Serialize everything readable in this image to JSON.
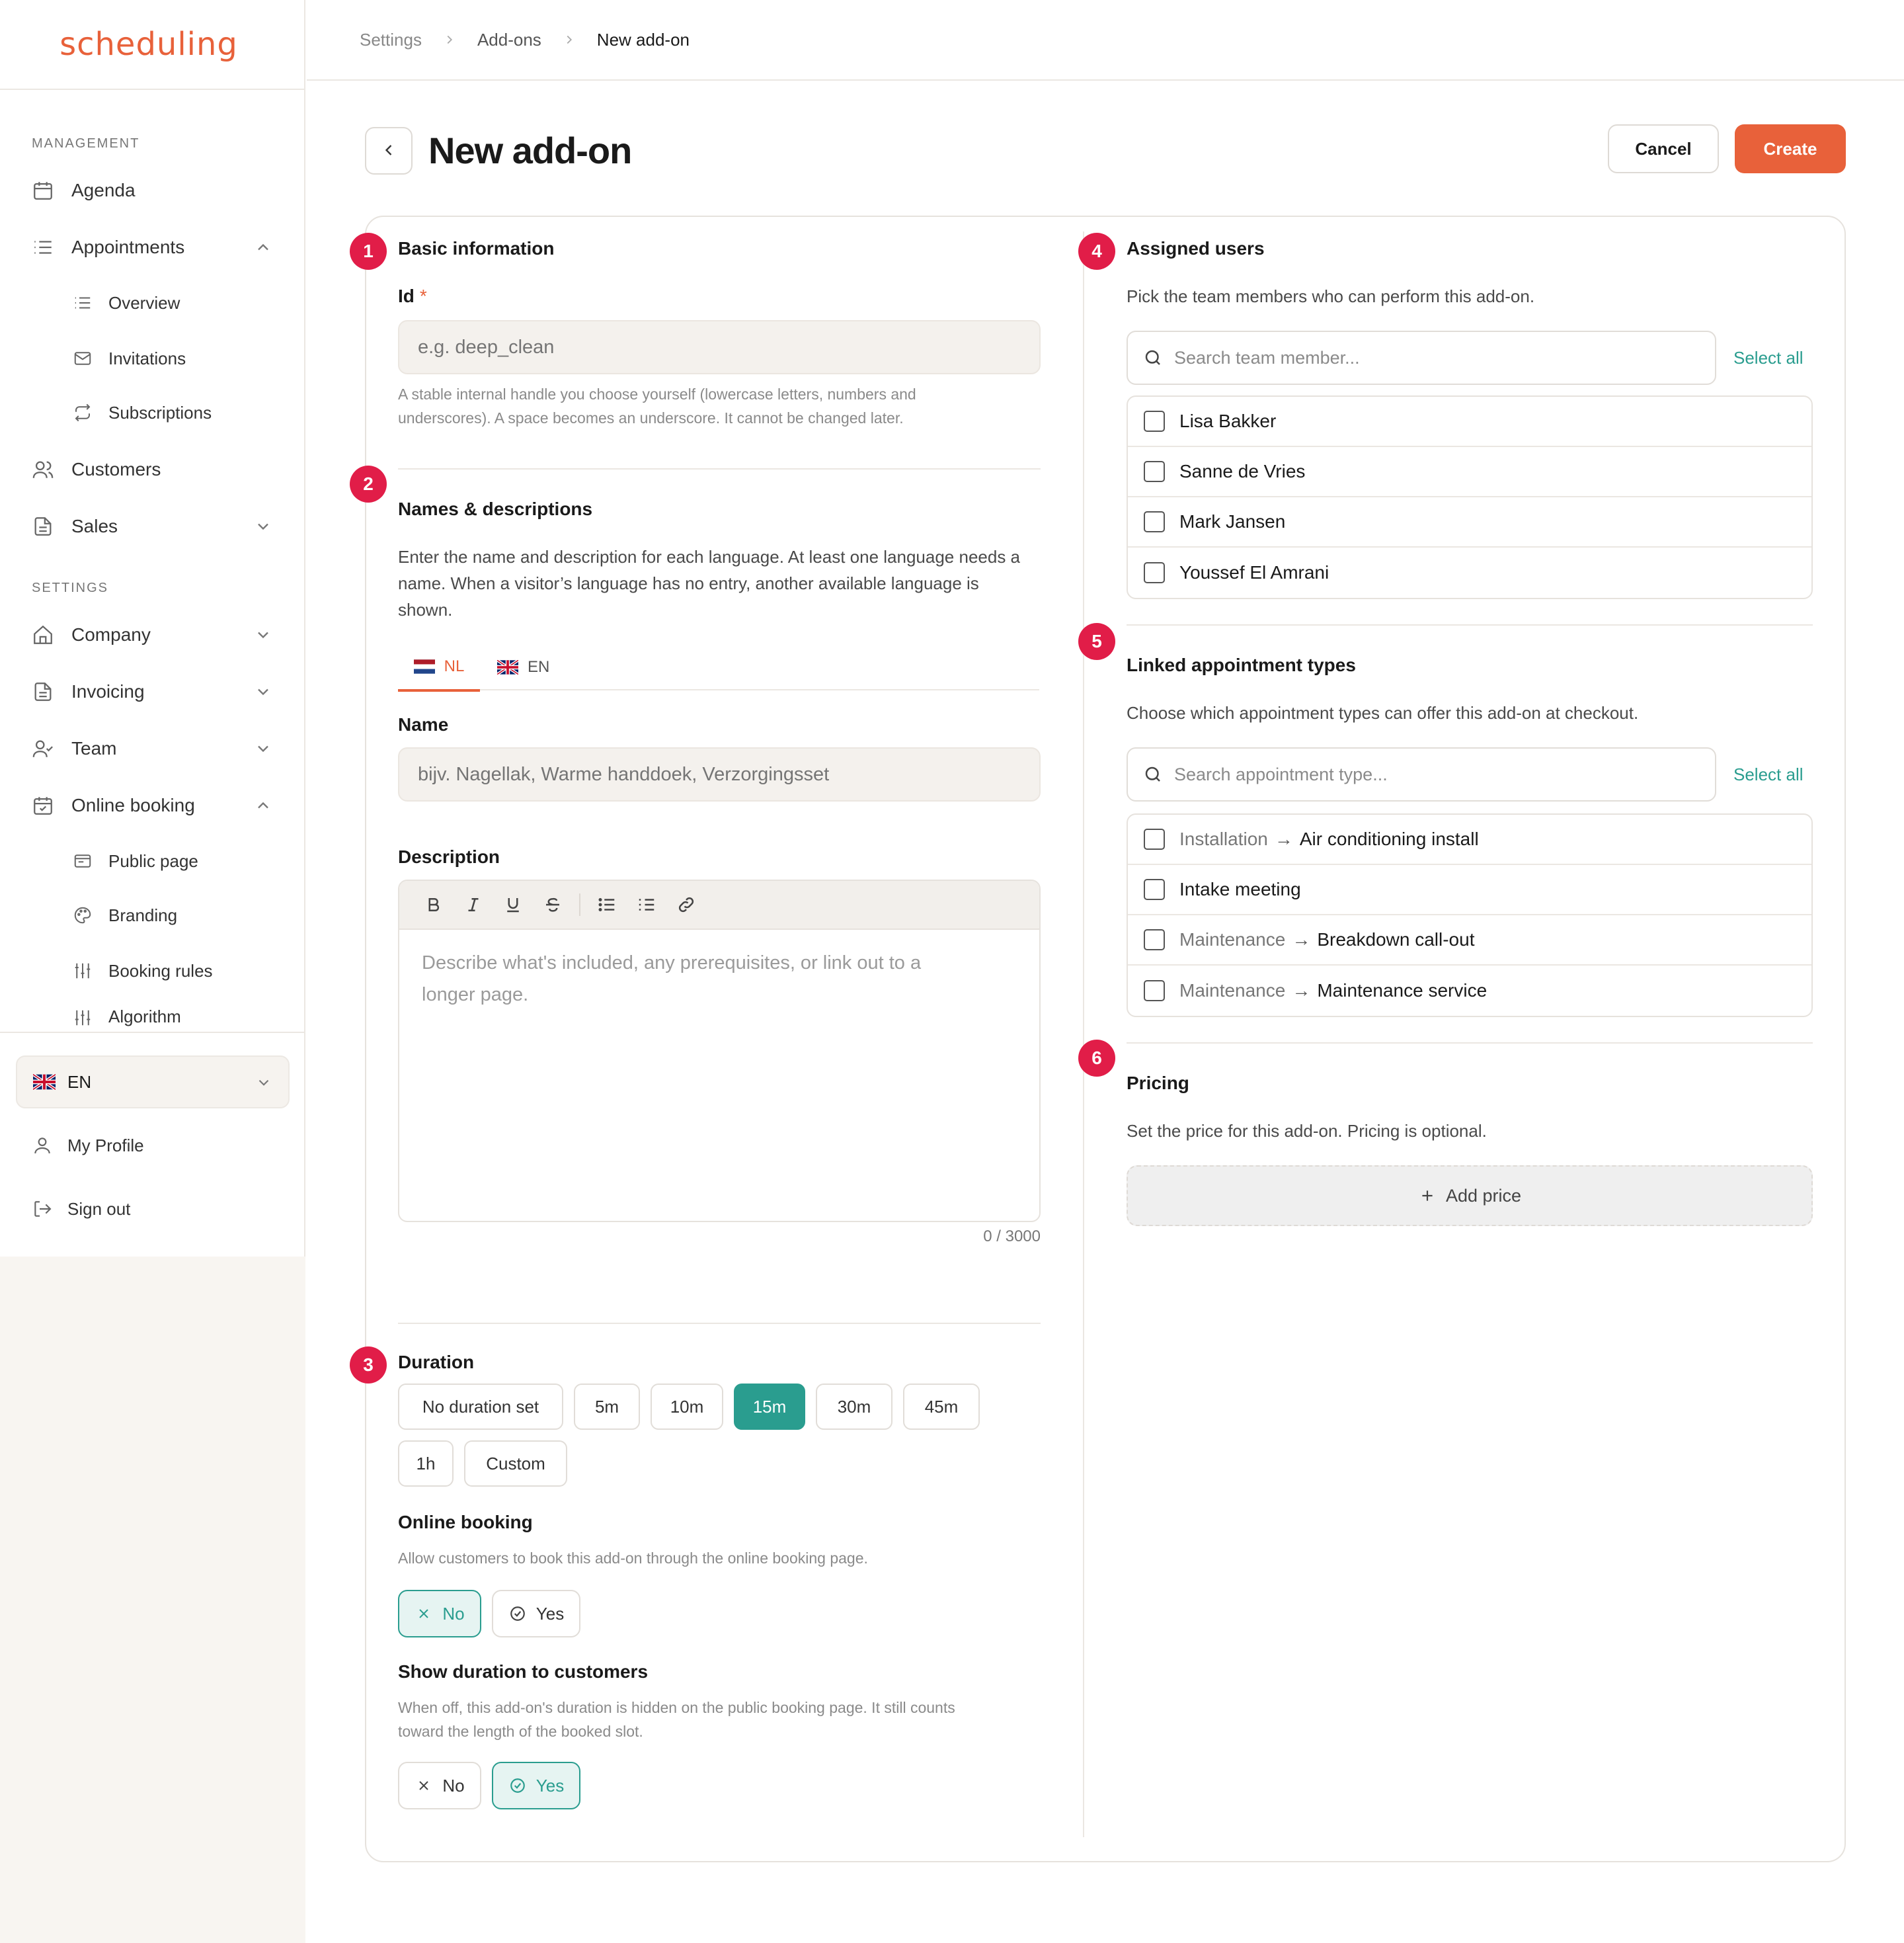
{
  "app": {
    "logo": "scheduling"
  },
  "sidebar": {
    "management_label": "MANAGEMENT",
    "settings_label": "SETTINGS",
    "items": {
      "agenda": "Agenda",
      "appointments": "Appointments",
      "overview": "Overview",
      "invitations": "Invitations",
      "subscriptions": "Subscriptions",
      "customers": "Customers",
      "sales": "Sales",
      "company": "Company",
      "invoicing": "Invoicing",
      "team": "Team",
      "online_booking": "Online booking",
      "public_page": "Public page",
      "branding": "Branding",
      "booking_rules": "Booking rules",
      "algorithm": "Algorithm"
    },
    "language": "EN",
    "my_profile": "My Profile",
    "sign_out": "Sign out"
  },
  "breadcrumb": [
    "Settings",
    "Add-ons",
    "New add-on"
  ],
  "header": {
    "title": "New add-on",
    "cancel": "Cancel",
    "create": "Create"
  },
  "basic": {
    "step": "1",
    "title": "Basic information",
    "id_label": "Id",
    "id_required": "*",
    "id_placeholder": "e.g. deep_clean",
    "id_help_1": "A stable internal handle you choose yourself (lowercase letters, numbers and",
    "id_help_2": "underscores). A space becomes an underscore. It cannot be changed later."
  },
  "names": {
    "step": "2",
    "title": "Names & descriptions",
    "desc_1": "Enter the name and description for each language. At least one language needs a",
    "desc_2": "name. When a visitor’s language has no entry, another available language is",
    "desc_3": "shown.",
    "tabs": [
      "NL",
      "EN"
    ],
    "name_label": "Name",
    "name_placeholder": "bijv. Nagellak, Warme handdoek, Verzorgingsset",
    "description_label": "Description",
    "editor_placeholder_1": "Describe what's included, any prerequisites, or link out to a",
    "editor_placeholder_2": "longer page.",
    "counter": "0 / 3000"
  },
  "duration": {
    "step": "3",
    "title": "Duration",
    "options": [
      "No duration set",
      "5m",
      "10m",
      "15m",
      "30m",
      "45m",
      "1h",
      "Custom"
    ],
    "selected": "15m",
    "online_booking_label": "Online booking",
    "online_booking_help": "Allow customers to book this add-on through the online booking page.",
    "online_booking_value": "No",
    "show_duration_label": "Show duration to customers",
    "show_duration_help_1": "When off, this add-on's duration is hidden on the public booking page. It still counts",
    "show_duration_help_2": "toward the length of the booked slot.",
    "show_duration_value": "Yes",
    "no": "No",
    "yes": "Yes"
  },
  "users": {
    "step": "4",
    "title": "Assigned users",
    "desc": "Pick the team members who can perform this add-on.",
    "search_placeholder": "Search team member...",
    "select_all": "Select all",
    "list": [
      "Lisa Bakker",
      "Sanne de Vries",
      "Mark Jansen",
      "Youssef El Amrani"
    ]
  },
  "types": {
    "step": "5",
    "title": "Linked appointment types",
    "desc": "Choose which appointment types can offer this add-on at checkout.",
    "search_placeholder": "Search appointment type...",
    "select_all": "Select all",
    "list": [
      {
        "group": "Installation",
        "name": "Air conditioning install"
      },
      {
        "group": "",
        "name": "Intake meeting"
      },
      {
        "group": "Maintenance",
        "name": "Breakdown call-out"
      },
      {
        "group": "Maintenance",
        "name": "Maintenance service"
      }
    ]
  },
  "pricing": {
    "step": "6",
    "title": "Pricing",
    "desc": "Set the price for this add-on. Pricing is optional.",
    "add_price": "Add price"
  },
  "colors": {
    "accent": "#e8613a",
    "teal": "#2a9d8f",
    "step": "#e11d48"
  }
}
